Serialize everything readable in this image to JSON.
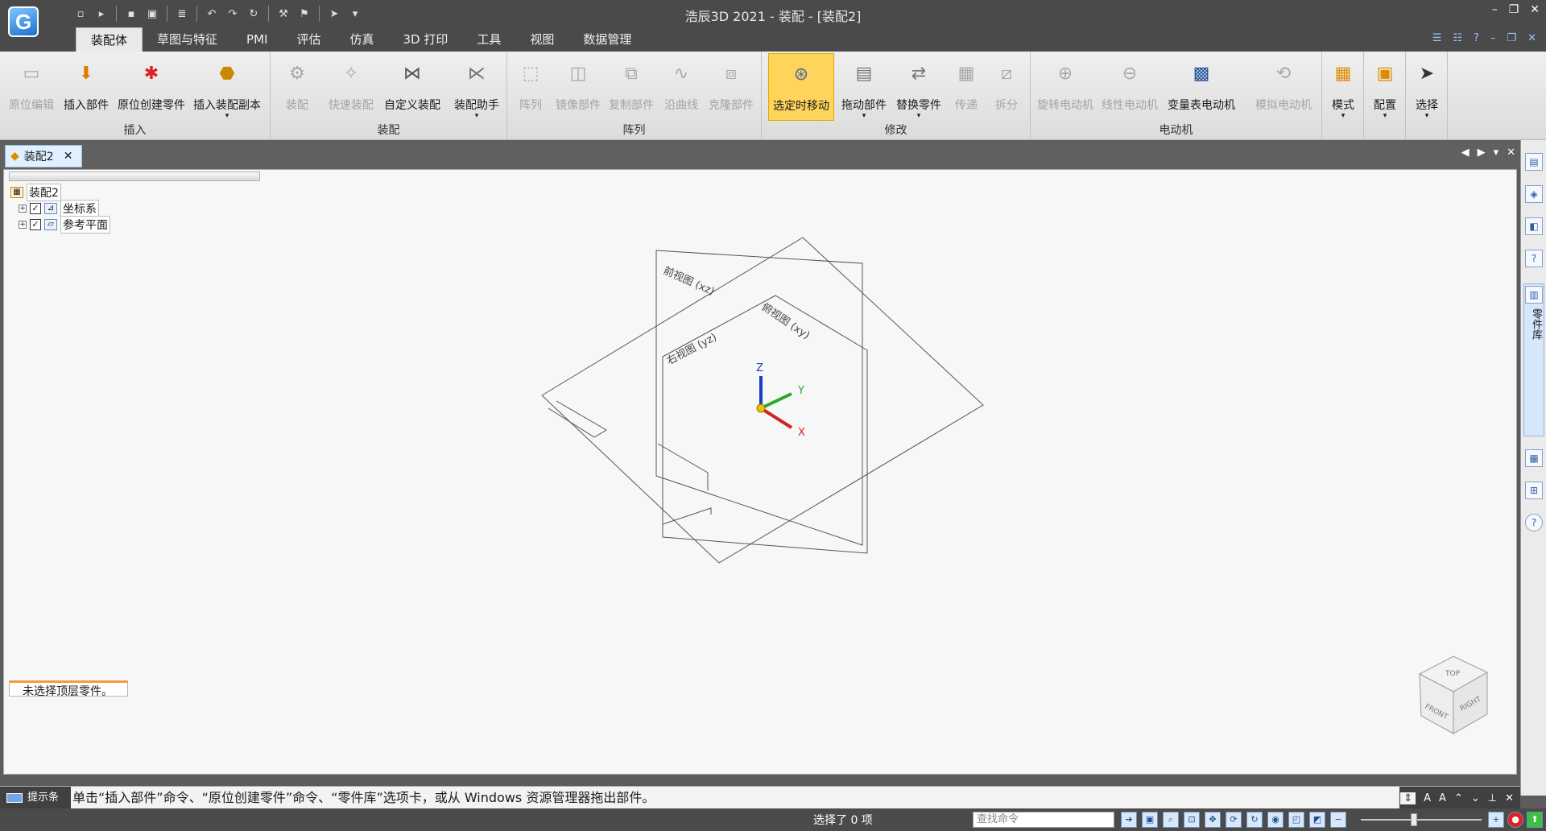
{
  "window": {
    "title": "浩辰3D 2021 - 装配 - [装配2]",
    "logo_letter": "G",
    "controls": [
      "–",
      "❐",
      "✕"
    ]
  },
  "quick_access": [
    "new-doc-icon",
    "open-icon",
    "save-icon",
    "print-icon",
    "undo-icon",
    "redo-icon",
    "select-icon",
    "customize-icon"
  ],
  "tabs": [
    "装配体",
    "草图与特征",
    "PMI",
    "评估",
    "仿真",
    "3D 打印",
    "工具",
    "视图",
    "数据管理"
  ],
  "active_tab": "装配体",
  "ribbon": {
    "groups": {
      "insert": "插入",
      "assemble": "装配",
      "pattern": "阵列",
      "modify": "修改",
      "motor": "电动机"
    },
    "buttons": {
      "in_place_edit": "原位编辑",
      "insert_part": "插入部件",
      "create_in_place": "原位创建零件",
      "insert_copy": "插入装配副本",
      "assemble": "装配",
      "quick_assemble": "快速装配",
      "custom_assemble": "自定义装配",
      "assembly_helper": "装配助手",
      "pattern": "阵列",
      "mirror_part": "镜像部件",
      "copy_part": "复制部件",
      "along_curve": "沿曲线",
      "clone_part": "克隆部件",
      "move_on_select": "选定时移动",
      "drag_part": "拖动部件",
      "replace_part": "替换零件",
      "transfer": "传递",
      "split": "拆分",
      "rotary_motor": "旋转电动机",
      "linear_motor": "线性电动机",
      "variable_table_motor": "变量表电动机",
      "simulate_motor": "模拟电动机",
      "mode": "模式",
      "config": "配置",
      "select": "选择"
    }
  },
  "document_tab": "装配2",
  "tree": {
    "root": "装配2",
    "items": [
      "坐标系",
      "参考平面"
    ]
  },
  "selection_note": "未选择顶层零件。",
  "planes": {
    "front": "前视图 (xz)",
    "top": "俯视图 (xy)",
    "right": "右视图 (yz)"
  },
  "axes": {
    "x": "X",
    "y": "Y",
    "z": "Z"
  },
  "view_cube": {
    "top": "TOP",
    "front": "FRONT",
    "right": "RIGHT"
  },
  "sidebar": {
    "library_tab": "零件库"
  },
  "prompt": {
    "label": "提示条",
    "text": "单击“插入部件”命令、“原位创建零件”命令、“零件库”选项卡，或从 Windows 资源管理器拖出部件。"
  },
  "status": {
    "selection": "选择了 0 项",
    "search_placeholder": "查找命令"
  }
}
